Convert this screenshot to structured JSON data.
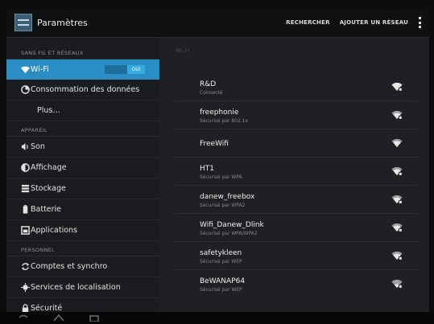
{
  "actionbar": {
    "title": "Paramètres",
    "search_label": "RECHERCHER",
    "add_network_label": "AJOUTER UN RÉSEAU"
  },
  "sidebar": {
    "sections": [
      {
        "header": "SANS FIL ET RÉSEAUX",
        "items": [
          {
            "label": "Wi-Fi",
            "icon": "wifi-icon",
            "toggle": "OUI",
            "selected": true
          },
          {
            "label": "Consommation des données",
            "icon": "data-usage-icon"
          },
          {
            "label": "Plus…",
            "icon": ""
          }
        ]
      },
      {
        "header": "APPAREIL",
        "items": [
          {
            "label": "Son",
            "icon": "sound-icon"
          },
          {
            "label": "Affichage",
            "icon": "display-icon"
          },
          {
            "label": "Stockage",
            "icon": "storage-icon"
          },
          {
            "label": "Batterie",
            "icon": "battery-icon"
          },
          {
            "label": "Applications",
            "icon": "apps-icon"
          }
        ]
      },
      {
        "header": "PERSONNEL",
        "items": [
          {
            "label": "Comptes et synchro",
            "icon": "sync-icon"
          },
          {
            "label": "Services de localisation",
            "icon": "location-icon"
          },
          {
            "label": "Sécurité",
            "icon": "lock-icon"
          }
        ]
      }
    ]
  },
  "wifi": {
    "header": "WI-FI",
    "networks": [
      {
        "name": "R&D",
        "status": "Connecté",
        "secured": true
      },
      {
        "name": "freephonie",
        "status": "Sécurisé par 802.1x",
        "secured": true
      },
      {
        "name": "FreeWifi",
        "status": "",
        "secured": false
      },
      {
        "name": "HT1",
        "status": "Sécurisé par WPA",
        "secured": true
      },
      {
        "name": "danew_freebox",
        "status": "Sécurisé par WPA2",
        "secured": true
      },
      {
        "name": "Wifi_Danew_Dlink",
        "status": "Sécurisé par WPA/WPA2",
        "secured": true
      },
      {
        "name": "safetykleen",
        "status": "Sécurisé par WEP",
        "secured": true
      },
      {
        "name": "BeWANAP64",
        "status": "Sécurisé par WEP",
        "secured": true
      }
    ]
  },
  "colors": {
    "accent": "#2a8ec4",
    "background": "#1b1c1f"
  }
}
